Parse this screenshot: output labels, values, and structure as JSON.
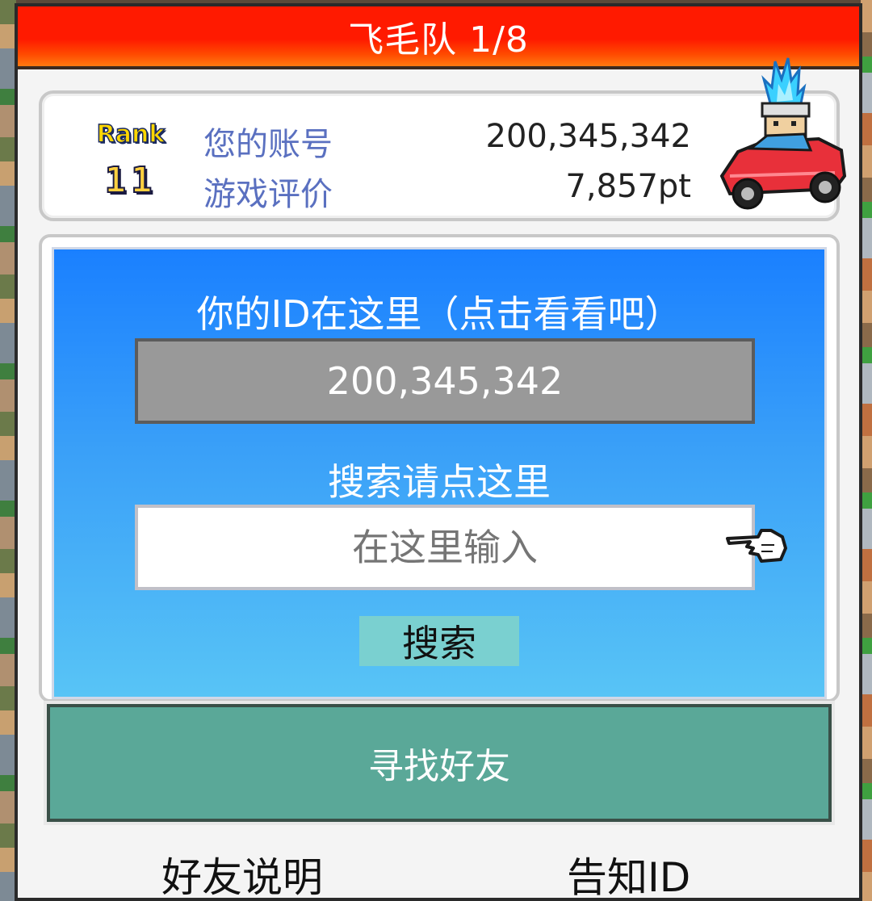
{
  "title_bar": {
    "title": "飞毛队 1/8"
  },
  "info_card": {
    "rank_label": "Rank",
    "rank_value": "11",
    "account_label": "您的账号",
    "account_value": "200,345,342",
    "rating_label": "游戏评价",
    "rating_value": "7,857pt",
    "avatar_icon": "racer-car-avatar-icon"
  },
  "id_section": {
    "prompt": "你的ID在这里（点击看看吧）",
    "id_value": "200,345,342"
  },
  "search_section": {
    "prompt": "搜索请点这里",
    "input_placeholder": "在这里输入",
    "input_value": "",
    "pointer_icon": "pointing-hand-icon",
    "search_button_label": "搜索"
  },
  "find_friends_button": {
    "label": "寻找好友"
  },
  "footer": {
    "friend_help_label": "好友说明",
    "share_id_label": "告知ID"
  },
  "colors": {
    "title_red": "#ff1a00",
    "blue_top": "#1a80ff",
    "blue_bottom": "#58c4f6",
    "teal_button": "#5aa898",
    "search_button": "#7ad0d0",
    "label_blue": "#5a70c0"
  }
}
